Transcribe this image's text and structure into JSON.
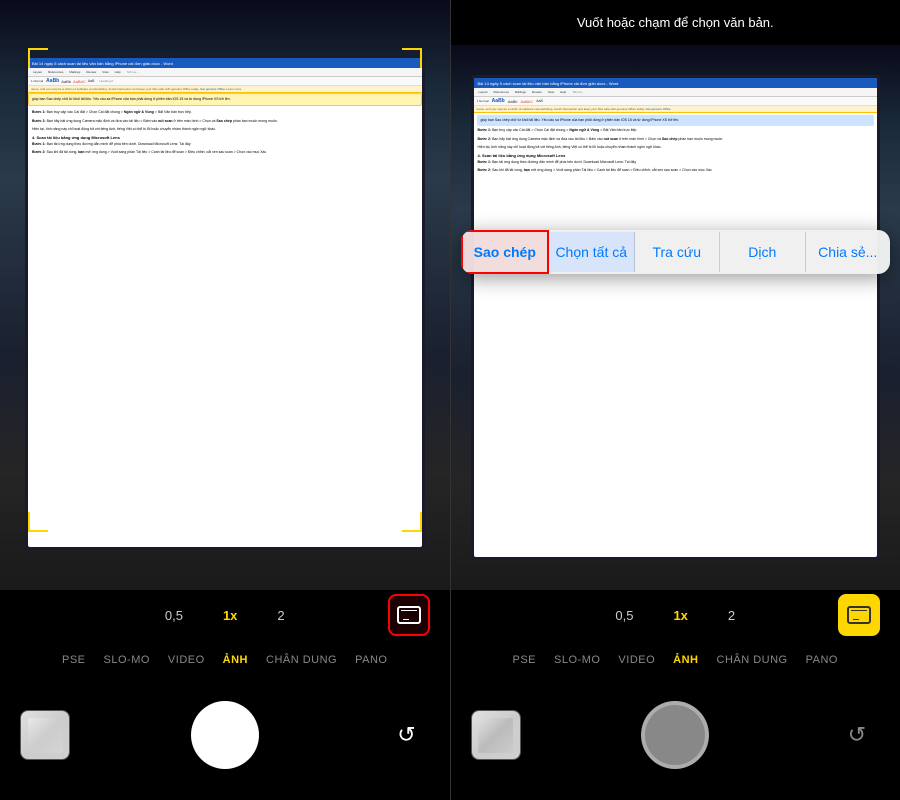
{
  "left_panel": {
    "hint": "",
    "zoom": {
      "half": "0,5",
      "one": "1x",
      "two": "2"
    },
    "modes": [
      "PSE",
      "SLO-MO",
      "VIDEO",
      "ẢNH",
      "CHÂN DUNG",
      "PANO"
    ],
    "active_mode": "ẢNH",
    "scan_button_label": "scan"
  },
  "right_panel": {
    "hint_text": "Vuốt hoặc chạm để chọn văn bản.",
    "zoom": {
      "half": "0,5",
      "one": "1x",
      "two": "2"
    },
    "modes": [
      "PSE",
      "SLO-MO",
      "VIDEO",
      "ẢNH",
      "CHÂN DUNG",
      "PANO"
    ],
    "active_mode": "ẢNH",
    "context_menu": {
      "buttons": [
        "Sao chép",
        "Chọn tất cả",
        "Tra cứu",
        "Dịch",
        "Chia sẻ..."
      ],
      "highlighted": "Sao chép"
    }
  },
  "document": {
    "title": "Bài 14 ngày 5 cách scan tài liệu văn bản bằng iPhone cài đơn giản.docx - Word",
    "tabs": [
      "Layout",
      "References",
      "Mailings",
      "Review",
      "View",
      "Help",
      "Tell me what you want to do"
    ],
    "content_blocks": [
      "giúp bạn Sao chép chữ từ khối tải liệu. Yêu cầu sa iPhone của bạn phải dùng ở phiên bản iOS 15 và từ dòng iPhone XS trở lên.",
      "Bước 1: Bạn truy cập vào Cài đặt > Chọn Cài đặt chung > Ngôn ngữ & Vùng > Bật Văn bản trực tiếp.",
      "Bước 2: Bạn hãy bật ứng dụng Camera mặc định và đưa vào tài liệu > Bấm vào nút scan ở trên màn hình > Chọn và Sao chép phần bạn muốn mong muốn.",
      "Hiện tại, tính năng này chỉ hoạt động tốt với tiếng Anh, tiếng Việt có thể bị lỗi hoặc chuyển nhầm thành ngôn ngữ khác.",
      "4. Scan tài liệu bằng ứng dụng Microsoft Lens",
      "Bước 1: Bạn tải ứng dụng theo đường dẫn mình đề phía bên dưới. Download Microsoft Lens: Tại đây",
      "Bước 2: Sau khi đã tải xong, bạn mở ứng dụng > Vuốt sang phần Tài liệu > Canh tài liệu để scan > Điều chỉnh; cắt xen sau scan > Chọn vào mục Xác"
    ]
  }
}
